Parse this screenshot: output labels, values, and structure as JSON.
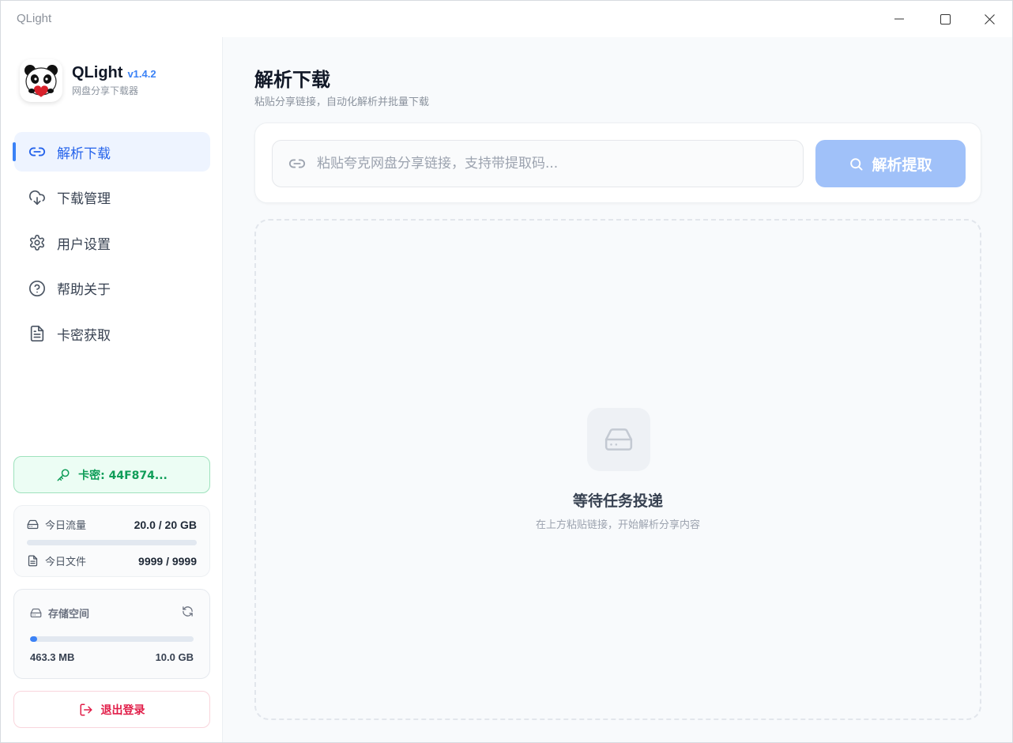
{
  "window": {
    "title": "QLight"
  },
  "brand": {
    "name": "QLight",
    "version": "v1.4.2",
    "subtitle": "网盘分享下载器"
  },
  "nav": [
    {
      "label": "解析下载",
      "icon": "link-icon",
      "active": true
    },
    {
      "label": "下载管理",
      "icon": "cloud-download-icon",
      "active": false
    },
    {
      "label": "用户设置",
      "icon": "gear-icon",
      "active": false
    },
    {
      "label": "帮助关于",
      "icon": "help-circle-icon",
      "active": false
    },
    {
      "label": "卡密获取",
      "icon": "document-icon",
      "active": false
    }
  ],
  "card_key": {
    "label": "卡密: 44F874..."
  },
  "usage": {
    "traffic_label": "今日流量",
    "traffic_value": "20.0 / 20 GB",
    "files_label": "今日文件",
    "files_value": "9999 / 9999"
  },
  "storage": {
    "label": "存储空间",
    "used": "463.3 MB",
    "total": "10.0 GB",
    "fill_fraction": 0.045
  },
  "logout": {
    "label": "退出登录"
  },
  "main": {
    "title": "解析下载",
    "subtitle": "粘贴分享链接，自动化解析并批量下载",
    "search_placeholder": "粘贴夸克网盘分享链接，支持带提取码...",
    "parse_button": "解析提取",
    "empty_title": "等待任务投递",
    "empty_subtitle": "在上方粘贴链接，开始解析分享内容"
  },
  "colors": {
    "accent": "#3b82f6",
    "accent_soft": "#a0c1f9",
    "success": "#0f9d58",
    "danger": "#e11d48"
  }
}
